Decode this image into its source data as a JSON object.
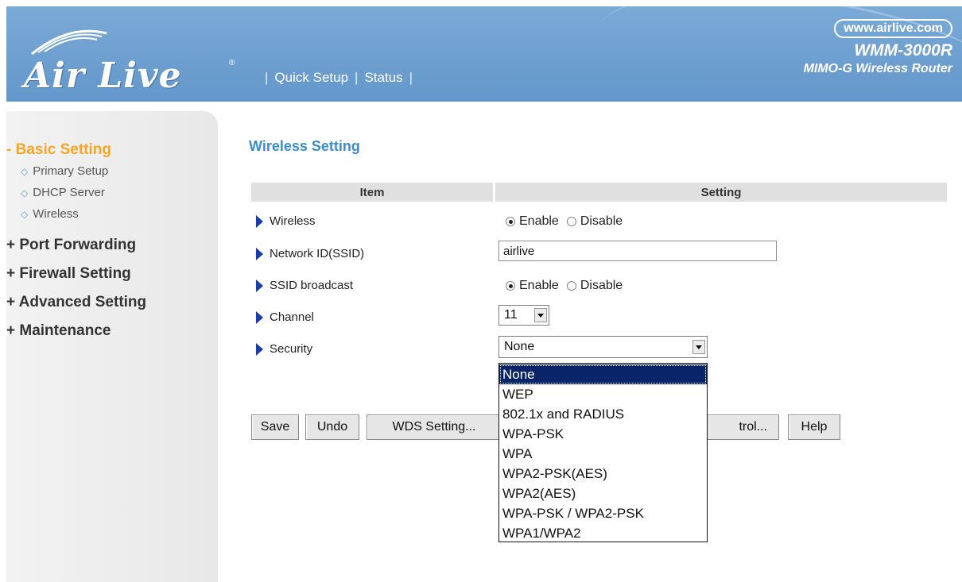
{
  "header": {
    "logo_text": "Air Live",
    "logo_reg": "®",
    "nav": [
      "Quick Setup",
      "Status"
    ],
    "url": "www.airlive.com",
    "model": "WMM-3000R",
    "description": "MIMO-G Wireless Router"
  },
  "sidebar": {
    "basic_setting": "- Basic Setting",
    "sub_items": [
      "Primary Setup",
      "DHCP Server",
      "Wireless"
    ],
    "port_forwarding": "+ Port Forwarding",
    "firewall_setting": "+ Firewall Setting",
    "advanced_setting": "+ Advanced Setting",
    "maintenance": "+ Maintenance"
  },
  "main": {
    "title": "Wireless Setting",
    "col_item": "Item",
    "col_setting": "Setting",
    "rows": {
      "wireless": "Wireless",
      "ssid": "Network ID(SSID)",
      "ssid_broadcast": "SSID broadcast",
      "channel": "Channel",
      "security": "Security"
    },
    "enable_label": "Enable",
    "disable_label": "Disable",
    "ssid_value": "airlive",
    "channel_value": "11",
    "security_value": "None",
    "security_options": [
      "None",
      "WEP",
      "802.1x and RADIUS",
      "WPA-PSK",
      "WPA",
      "WPA2-PSK(AES)",
      "WPA2(AES)",
      "WPA-PSK / WPA2-PSK",
      "WPA1/WPA2"
    ],
    "buttons": {
      "save": "Save",
      "undo": "Undo",
      "wds": "WDS Setting...",
      "access_control": "trol...",
      "help": "Help"
    }
  }
}
